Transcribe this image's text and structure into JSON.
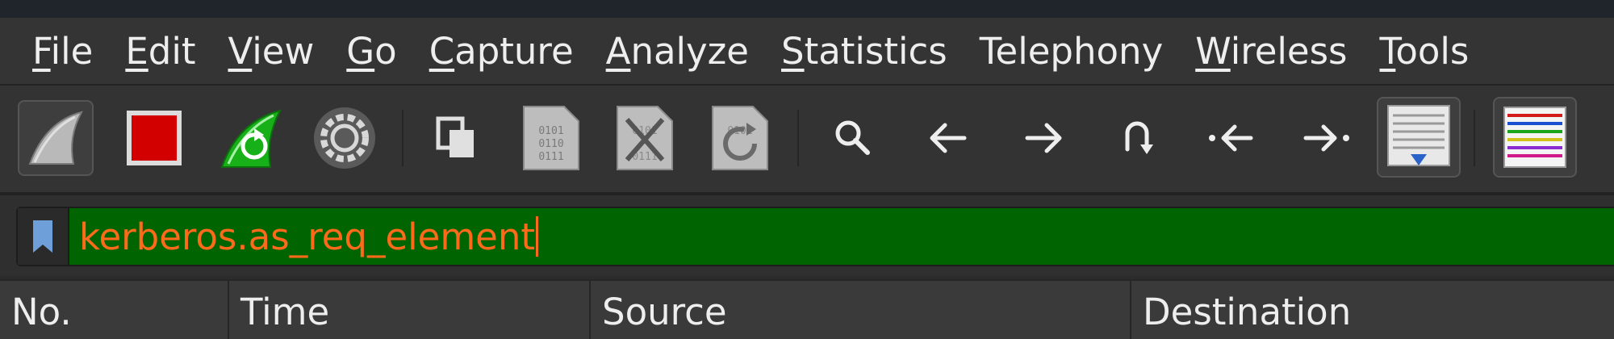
{
  "menubar": {
    "items": [
      {
        "mnemonic": "F",
        "rest": "ile"
      },
      {
        "mnemonic": "E",
        "rest": "dit"
      },
      {
        "mnemonic": "V",
        "rest": "iew"
      },
      {
        "mnemonic": "G",
        "rest": "o"
      },
      {
        "mnemonic": "C",
        "rest": "apture"
      },
      {
        "mnemonic": "A",
        "rest": "nalyze"
      },
      {
        "mnemonic": "S",
        "rest": "tatistics"
      },
      {
        "mnemonic": "",
        "rest": "Telephony"
      },
      {
        "mnemonic": "W",
        "rest": "ireless"
      },
      {
        "mnemonic": "T",
        "rest": "ools"
      }
    ]
  },
  "toolbar": {
    "buttons": [
      "start-capture-icon",
      "stop-capture-icon",
      "restart-capture-icon",
      "capture-options-icon",
      "open-file-icon",
      "save-file-icon",
      "close-file-icon",
      "reload-file-icon",
      "find-packet-icon",
      "go-back-icon",
      "go-forward-icon",
      "go-to-packet-icon",
      "go-first-packet-icon",
      "go-last-packet-icon",
      "auto-scroll-icon",
      "colorize-icon"
    ]
  },
  "filter": {
    "value": "kerberos.as_req_element",
    "background_color": "#006400",
    "text_color": "#ff6a1a"
  },
  "packet_list": {
    "columns": [
      "No.",
      "Time",
      "Source",
      "Destination"
    ]
  }
}
